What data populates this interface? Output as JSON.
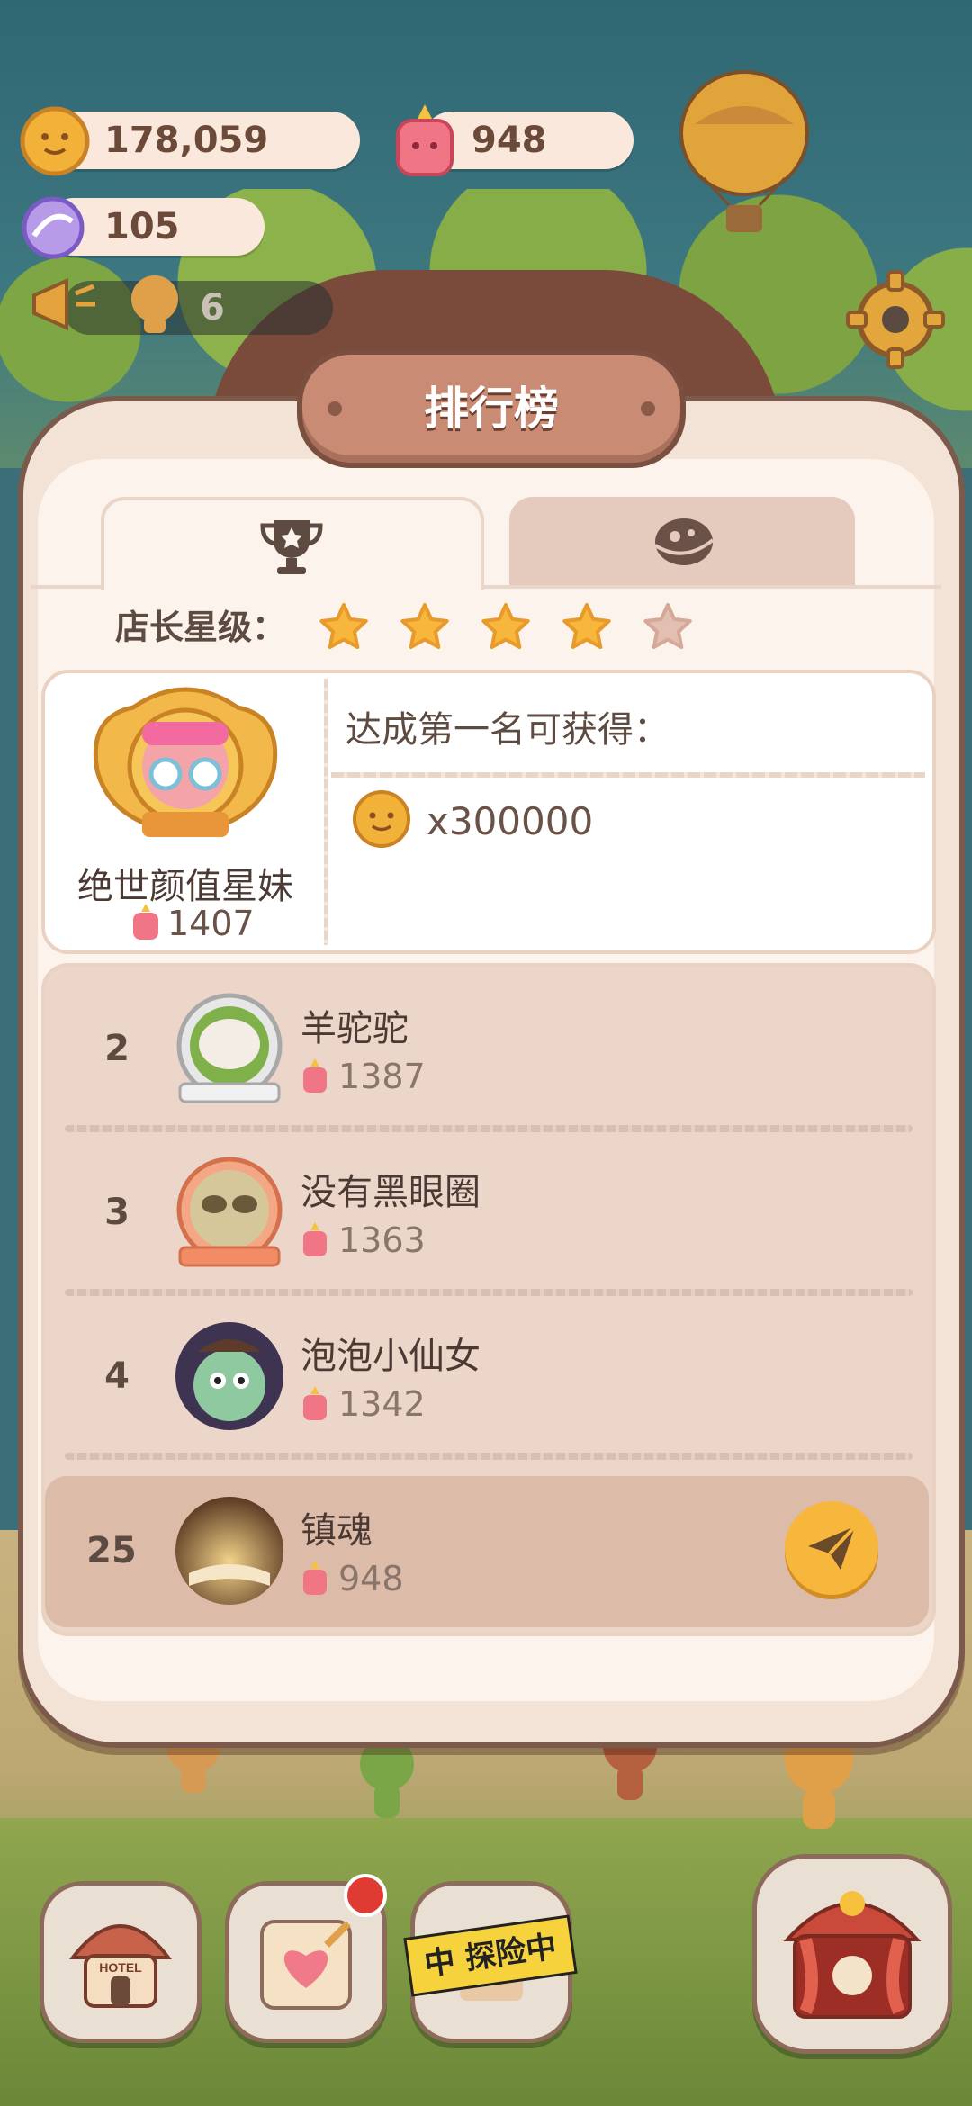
{
  "hud": {
    "coins": "178,059",
    "gems": "948",
    "candy": "105",
    "horn_count": "6"
  },
  "panel": {
    "title": "排行榜",
    "tabs": [
      {
        "icon": "trophy-icon",
        "active": true
      },
      {
        "icon": "planet-icon",
        "active": false
      }
    ],
    "stars_label": "店长星级：",
    "stars": {
      "filled": 4,
      "total": 5
    }
  },
  "top_player": {
    "name": "绝世颜值星妹",
    "score": "1407",
    "reward_label": "达成第一名可获得：",
    "reward_amount": "x300000"
  },
  "ranking": [
    {
      "rank": "2",
      "name": "羊驼驼",
      "score": "1387"
    },
    {
      "rank": "3",
      "name": "没有黑眼圈",
      "score": "1363"
    },
    {
      "rank": "4",
      "name": "泡泡小仙女",
      "score": "1342"
    }
  ],
  "me": {
    "rank": "25",
    "name": "镇魂",
    "score": "948"
  },
  "bottom_nav": {
    "exploring_label": "中 探险中",
    "hotel_label": "HOTEL"
  },
  "colors": {
    "panel_bg": "#fbf3ec",
    "panel_border": "#7b5a4c",
    "title_banner": "#c98b74",
    "star_filled": "#f6b73c",
    "star_empty": "#e2c0b1",
    "share_button": "#f6b73c"
  }
}
